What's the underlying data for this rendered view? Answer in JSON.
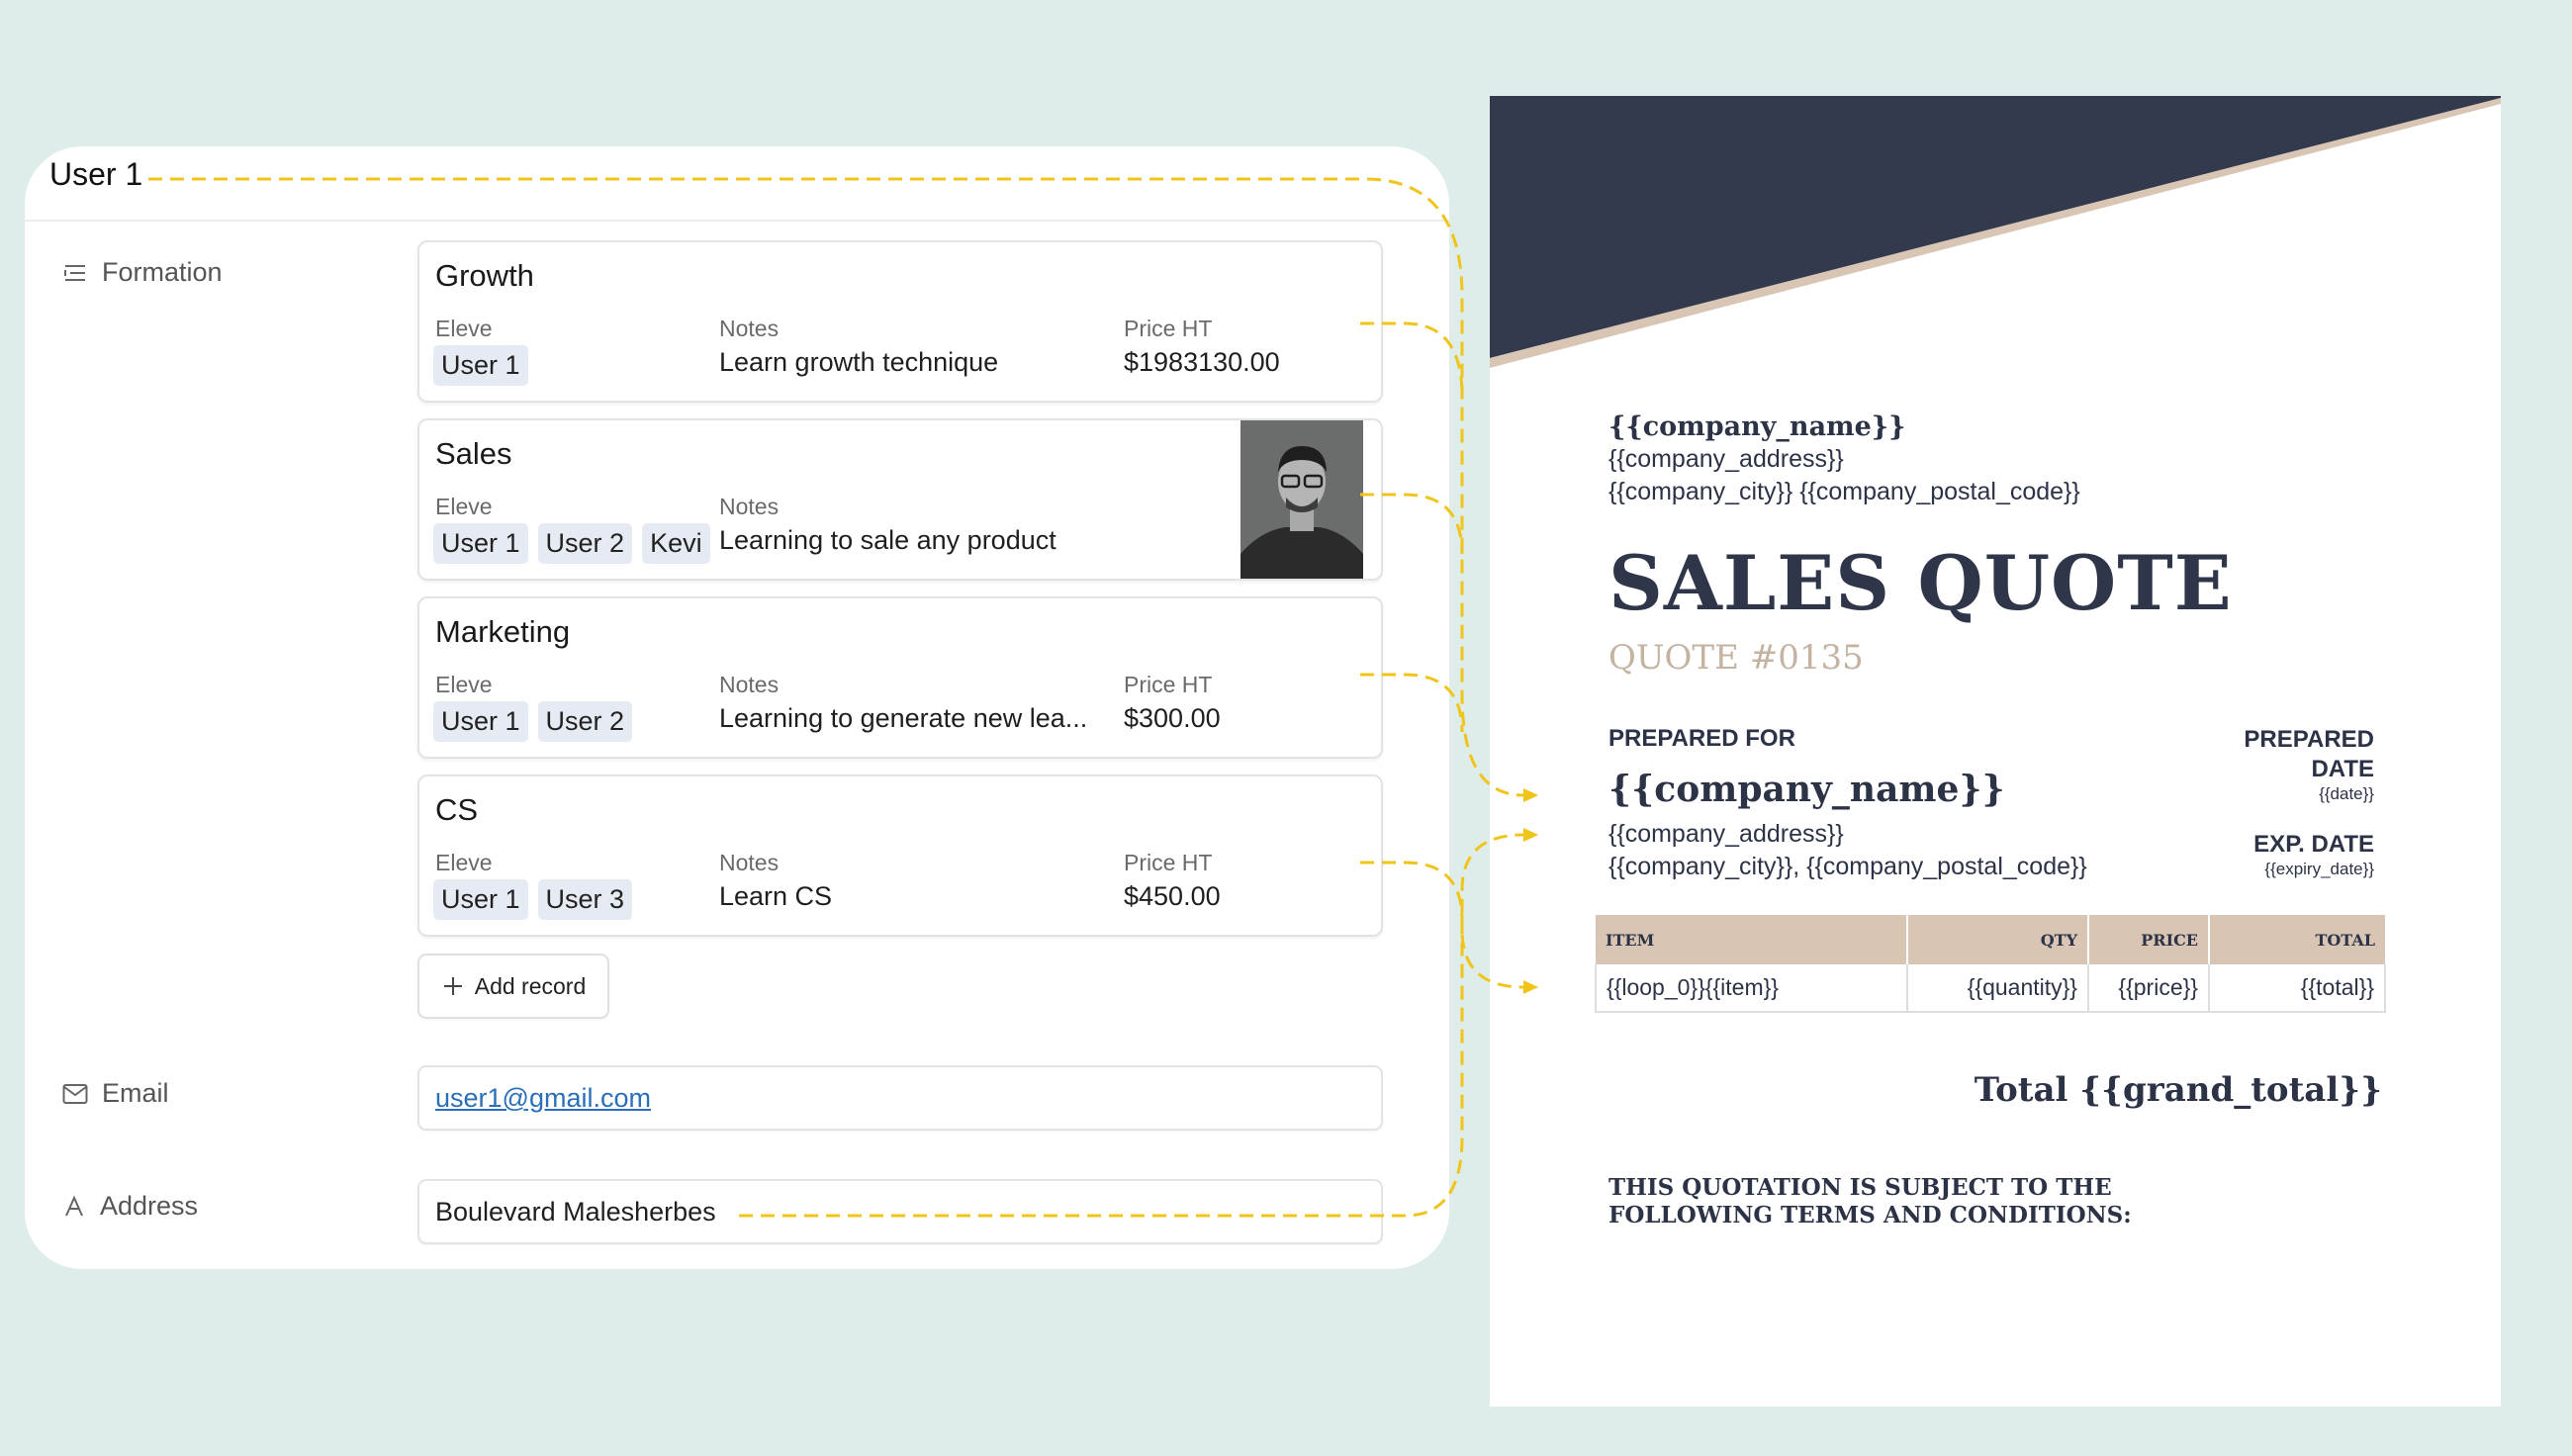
{
  "record": {
    "title": "User 1",
    "formation_label": "Formation",
    "email_label": "Email",
    "address_label": "Address",
    "add_record_label": "Add record",
    "email_value": "user1@gmail.com",
    "address_value": "Boulevard Malesherbes",
    "columns": {
      "eleve": "Eleve",
      "notes": "Notes",
      "price": "Price HT"
    },
    "cards": [
      {
        "title": "Growth",
        "users": [
          "User 1"
        ],
        "notes": "Learn growth technique",
        "price": "$1983130.00"
      },
      {
        "title": "Sales",
        "users": [
          "User 1",
          "User 2",
          "Kevi"
        ],
        "notes": "Learning to sale any product",
        "price": ""
      },
      {
        "title": "Marketing",
        "users": [
          "User 1",
          "User 2"
        ],
        "notes": "Learning to generate new lea...",
        "price": "$300.00"
      },
      {
        "title": "CS",
        "users": [
          "User 1",
          "User 3"
        ],
        "notes": "Learn CS",
        "price": "$450.00"
      }
    ]
  },
  "doc": {
    "company_name": "{{company_name}}",
    "company_address": "{{company_address}}",
    "company_city_line": "{{company_city}} {{company_postal_code}}",
    "title": "SALES QUOTE",
    "quote_number": "QUOTE #0135",
    "prepared_for_label": "PREPARED FOR",
    "client_name": "{{company_name}}",
    "client_address": "{{company_address}}",
    "client_city_line": "{{company_city}}, {{company_postal_code}}",
    "prepared_date_label_1": "PREPARED",
    "prepared_date_label_2": "DATE",
    "prepared_date_value": "{{date}}",
    "exp_date_label": "EXP. DATE",
    "exp_date_value": "{{expiry_date}}",
    "table_headers": {
      "item": "ITEM",
      "qty": "QTY",
      "price": "PRICE",
      "total": "TOTAL"
    },
    "table_row": {
      "item": "{{loop_0}}{{item}}",
      "qty": "{{quantity}}",
      "price": "{{price}}",
      "total": "{{total}}"
    },
    "grand_total": "Total {{grand_total}}",
    "terms": "THIS QUOTATION IS SUBJECT TO THE FOLLOWING TERMS AND CONDITIONS:"
  },
  "colors": {
    "background": "#deede9",
    "connector": "#f0c419",
    "banner": "#333a4e",
    "accent_beige": "#d8c5b3",
    "link": "#2a6fb7"
  }
}
